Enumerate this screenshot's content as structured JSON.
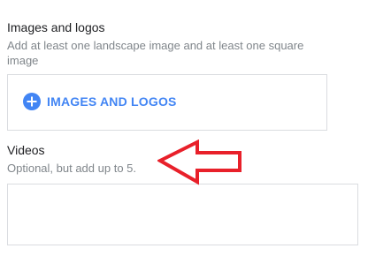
{
  "images_section": {
    "title": "Images and logos",
    "description": "Add at least one landscape image and at least one square image",
    "add_button_label": "IMAGES AND LOGOS",
    "add_icon": "plus-circle-icon"
  },
  "videos_section": {
    "title": "Videos",
    "description": "Optional, but add up to 5."
  },
  "annotation": {
    "icon": "red-arrow-left-icon",
    "color": "#e8202a"
  },
  "colors": {
    "accent": "#4285f4",
    "text_primary": "#202124",
    "text_secondary": "#80868b",
    "border": "#dadce0"
  }
}
